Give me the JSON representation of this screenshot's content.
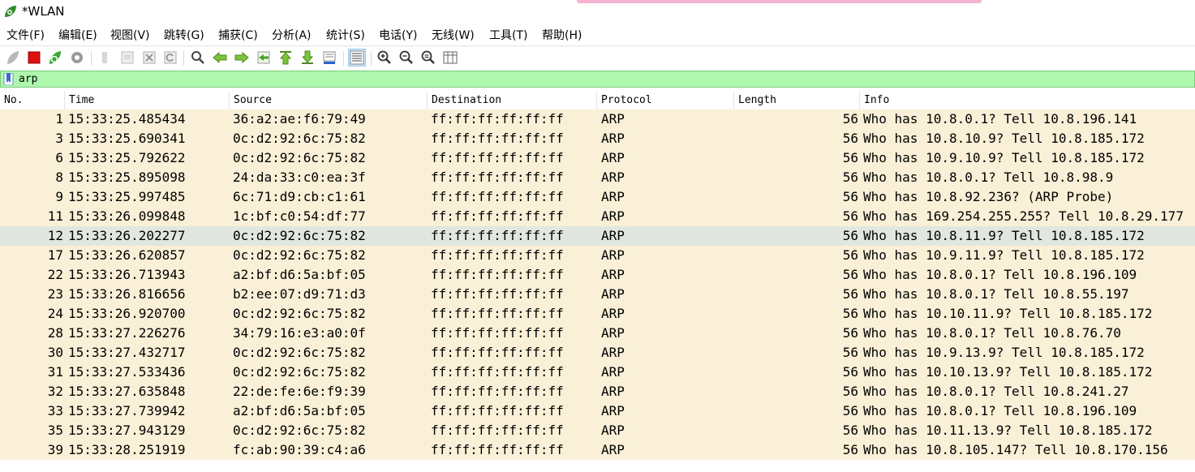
{
  "window": {
    "title": "*WLAN"
  },
  "menu": [
    "文件(F)",
    "编辑(E)",
    "视图(V)",
    "跳转(G)",
    "捕获(C)",
    "分析(A)",
    "统计(S)",
    "电话(Y)",
    "无线(W)",
    "工具(T)",
    "帮助(H)"
  ],
  "toolbar": {
    "icons": [
      "start-capture-icon",
      "stop-capture-icon",
      "restart-capture-icon",
      "capture-options-icon",
      "open-file-icon",
      "save-file-icon",
      "close-file-icon",
      "reload-file-icon",
      "find-packet-icon",
      "go-back-icon",
      "go-forward-icon",
      "go-to-packet-icon",
      "go-first-icon",
      "go-last-icon",
      "auto-scroll-icon",
      "colorize-icon",
      "zoom-in-icon",
      "zoom-out-icon",
      "zoom-normal-icon",
      "resize-columns-icon"
    ]
  },
  "filter": {
    "value": "arp"
  },
  "columns": [
    "No.",
    "Time",
    "Source",
    "Destination",
    "Protocol",
    "Length",
    "Info"
  ],
  "packets": [
    {
      "no": "1",
      "time": "15:33:25.485434",
      "src": "36:a2:ae:f6:79:49",
      "dst": "ff:ff:ff:ff:ff:ff",
      "proto": "ARP",
      "len": "56",
      "info": "Who has 10.8.0.1? Tell 10.8.196.141"
    },
    {
      "no": "3",
      "time": "15:33:25.690341",
      "src": "0c:d2:92:6c:75:82",
      "dst": "ff:ff:ff:ff:ff:ff",
      "proto": "ARP",
      "len": "56",
      "info": "Who has 10.8.10.9? Tell 10.8.185.172"
    },
    {
      "no": "6",
      "time": "15:33:25.792622",
      "src": "0c:d2:92:6c:75:82",
      "dst": "ff:ff:ff:ff:ff:ff",
      "proto": "ARP",
      "len": "56",
      "info": "Who has 10.9.10.9? Tell 10.8.185.172"
    },
    {
      "no": "8",
      "time": "15:33:25.895098",
      "src": "24:da:33:c0:ea:3f",
      "dst": "ff:ff:ff:ff:ff:ff",
      "proto": "ARP",
      "len": "56",
      "info": "Who has 10.8.0.1? Tell 10.8.98.9"
    },
    {
      "no": "9",
      "time": "15:33:25.997485",
      "src": "6c:71:d9:cb:c1:61",
      "dst": "ff:ff:ff:ff:ff:ff",
      "proto": "ARP",
      "len": "56",
      "info": "Who has 10.8.92.236? (ARP Probe)"
    },
    {
      "no": "11",
      "time": "15:33:26.099848",
      "src": "1c:bf:c0:54:df:77",
      "dst": "ff:ff:ff:ff:ff:ff",
      "proto": "ARP",
      "len": "56",
      "info": "Who has 169.254.255.255? Tell 10.8.29.177"
    },
    {
      "no": "12",
      "time": "15:33:26.202277",
      "src": "0c:d2:92:6c:75:82",
      "dst": "ff:ff:ff:ff:ff:ff",
      "proto": "ARP",
      "len": "56",
      "info": "Who has 10.8.11.9? Tell 10.8.185.172",
      "selected": true
    },
    {
      "no": "17",
      "time": "15:33:26.620857",
      "src": "0c:d2:92:6c:75:82",
      "dst": "ff:ff:ff:ff:ff:ff",
      "proto": "ARP",
      "len": "56",
      "info": "Who has 10.9.11.9? Tell 10.8.185.172"
    },
    {
      "no": "22",
      "time": "15:33:26.713943",
      "src": "a2:bf:d6:5a:bf:05",
      "dst": "ff:ff:ff:ff:ff:ff",
      "proto": "ARP",
      "len": "56",
      "info": "Who has 10.8.0.1? Tell 10.8.196.109"
    },
    {
      "no": "23",
      "time": "15:33:26.816656",
      "src": "b2:ee:07:d9:71:d3",
      "dst": "ff:ff:ff:ff:ff:ff",
      "proto": "ARP",
      "len": "56",
      "info": "Who has 10.8.0.1? Tell 10.8.55.197"
    },
    {
      "no": "24",
      "time": "15:33:26.920700",
      "src": "0c:d2:92:6c:75:82",
      "dst": "ff:ff:ff:ff:ff:ff",
      "proto": "ARP",
      "len": "56",
      "info": "Who has 10.10.11.9? Tell 10.8.185.172"
    },
    {
      "no": "28",
      "time": "15:33:27.226276",
      "src": "34:79:16:e3:a0:0f",
      "dst": "ff:ff:ff:ff:ff:ff",
      "proto": "ARP",
      "len": "56",
      "info": "Who has 10.8.0.1? Tell 10.8.76.70"
    },
    {
      "no": "30",
      "time": "15:33:27.432717",
      "src": "0c:d2:92:6c:75:82",
      "dst": "ff:ff:ff:ff:ff:ff",
      "proto": "ARP",
      "len": "56",
      "info": "Who has 10.9.13.9? Tell 10.8.185.172"
    },
    {
      "no": "31",
      "time": "15:33:27.533436",
      "src": "0c:d2:92:6c:75:82",
      "dst": "ff:ff:ff:ff:ff:ff",
      "proto": "ARP",
      "len": "56",
      "info": "Who has 10.10.13.9? Tell 10.8.185.172"
    },
    {
      "no": "32",
      "time": "15:33:27.635848",
      "src": "22:de:fe:6e:f9:39",
      "dst": "ff:ff:ff:ff:ff:ff",
      "proto": "ARP",
      "len": "56",
      "info": "Who has 10.8.0.1? Tell 10.8.241.27"
    },
    {
      "no": "33",
      "time": "15:33:27.739942",
      "src": "a2:bf:d6:5a:bf:05",
      "dst": "ff:ff:ff:ff:ff:ff",
      "proto": "ARP",
      "len": "56",
      "info": "Who has 10.8.0.1? Tell 10.8.196.109"
    },
    {
      "no": "35",
      "time": "15:33:27.943129",
      "src": "0c:d2:92:6c:75:82",
      "dst": "ff:ff:ff:ff:ff:ff",
      "proto": "ARP",
      "len": "56",
      "info": "Who has 10.11.13.9? Tell 10.8.185.172"
    },
    {
      "no": "39",
      "time": "15:33:28.251919",
      "src": "fc:ab:90:39:c4:a6",
      "dst": "ff:ff:ff:ff:ff:ff",
      "proto": "ARP",
      "len": "56",
      "info": "Who has 10.8.105.147? Tell 10.8.170.156"
    }
  ],
  "colors": {
    "row_bg": "#faf0d7",
    "selected_row_bg": "#e1e6e0",
    "filter_bg": "#aff7af"
  }
}
